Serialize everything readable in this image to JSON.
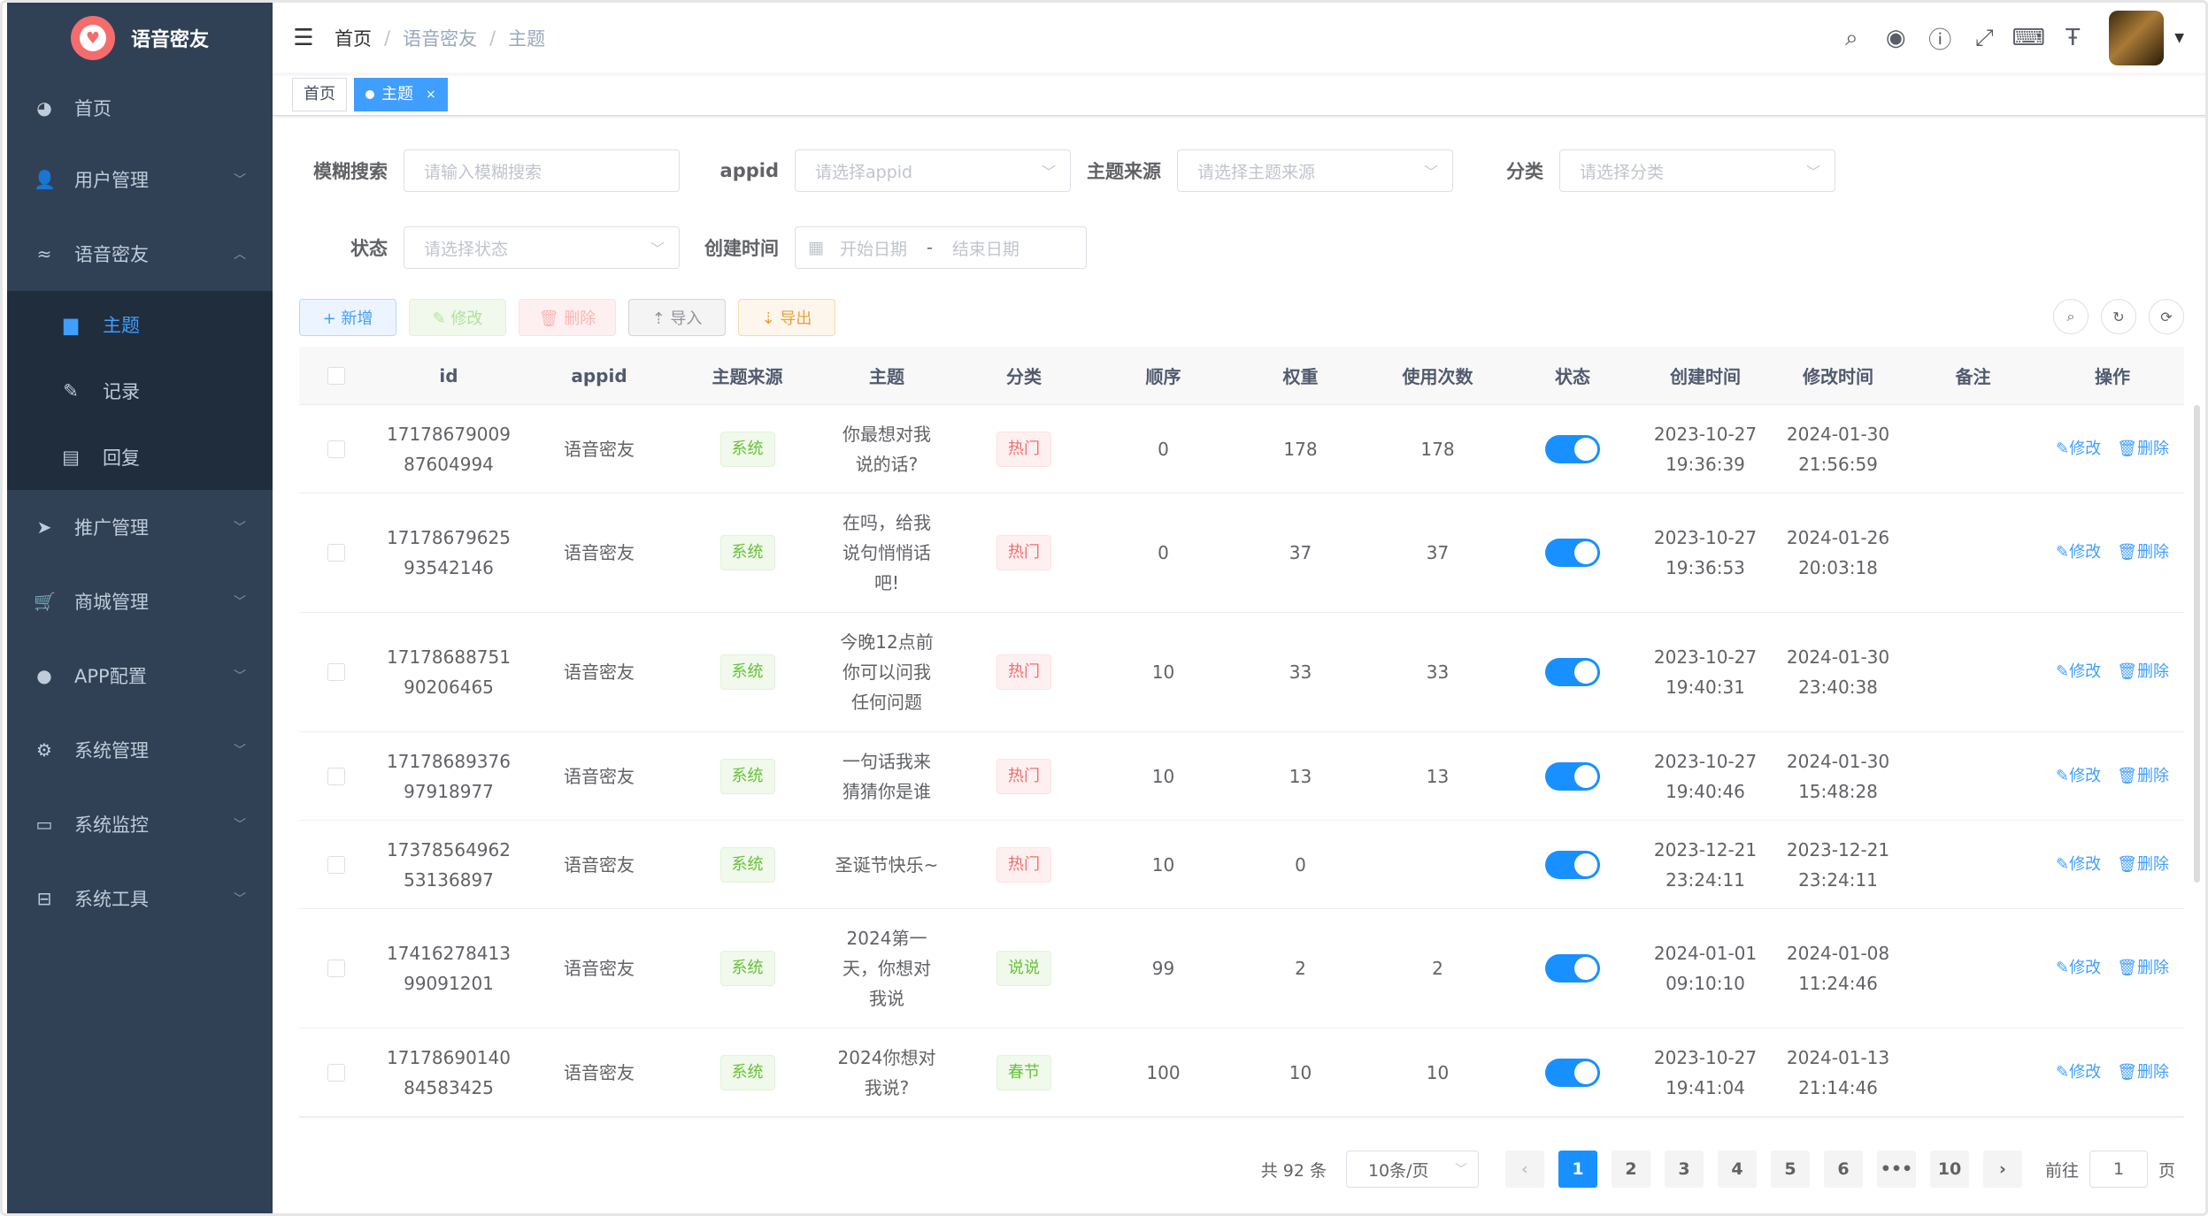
{
  "app": {
    "title": "语音密友"
  },
  "sidebar": {
    "items": [
      {
        "label": "首页",
        "icon": "dashboard-icon"
      },
      {
        "label": "用户管理",
        "icon": "user-icon"
      },
      {
        "label": "语音密友",
        "icon": "eye-icon"
      },
      {
        "label": "推广管理",
        "icon": "send-icon"
      },
      {
        "label": "商城管理",
        "icon": "cart-icon"
      },
      {
        "label": "APP配置",
        "icon": "wechat-icon"
      },
      {
        "label": "系统管理",
        "icon": "gear-icon"
      },
      {
        "label": "系统监控",
        "icon": "monitor-icon"
      },
      {
        "label": "系统工具",
        "icon": "toolbox-icon"
      }
    ],
    "sub_items": [
      {
        "label": "主题",
        "icon": "topic-icon"
      },
      {
        "label": "记录",
        "icon": "edit-icon"
      },
      {
        "label": "回复",
        "icon": "message-icon"
      }
    ]
  },
  "breadcrumb": {
    "home": "首页",
    "level1": "语音密友",
    "level2": "主题"
  },
  "tags": {
    "home": "首页",
    "active": "主题"
  },
  "search": {
    "fuzzy_label": "模糊搜索",
    "fuzzy_placeholder": "请输入模糊搜索",
    "appid_label": "appid",
    "appid_placeholder": "请选择appid",
    "source_label": "主题来源",
    "source_placeholder": "请选择主题来源",
    "category_label": "分类",
    "category_placeholder": "请选择分类",
    "status_label": "状态",
    "status_placeholder": "请选择状态",
    "created_label": "创建时间",
    "start_placeholder": "开始日期",
    "date_sep": "-",
    "end_placeholder": "结束日期"
  },
  "toolbar": {
    "add": "+ 新增",
    "edit": "✎ 修改",
    "delete": "🗑 删除",
    "import": "⇡ 导入",
    "export": "⇣ 导出"
  },
  "table": {
    "headers": [
      "id",
      "appid",
      "主题来源",
      "主题",
      "分类",
      "顺序",
      "权重",
      "使用次数",
      "状态",
      "创建时间",
      "修改时间",
      "备注",
      "操作"
    ],
    "edit_label": "修改",
    "delete_label": "删除",
    "rows": [
      {
        "id1": "17178679009",
        "id2": "87604994",
        "appid": "语音密友",
        "source": "系统",
        "topic": [
          "你最想对我",
          "说的话?"
        ],
        "category": "热门",
        "cat_color": "red",
        "order": "0",
        "weight": "178",
        "uses": "178",
        "created": [
          "2023-10-27",
          "19:36:39"
        ],
        "modified": [
          "2024-01-30",
          "21:56:59"
        ],
        "note": ""
      },
      {
        "id1": "17178679625",
        "id2": "93542146",
        "appid": "语音密友",
        "source": "系统",
        "topic": [
          "在吗，给我",
          "说句悄悄话",
          "吧!"
        ],
        "category": "热门",
        "cat_color": "red",
        "order": "0",
        "weight": "37",
        "uses": "37",
        "created": [
          "2023-10-27",
          "19:36:53"
        ],
        "modified": [
          "2024-01-26",
          "20:03:18"
        ],
        "note": ""
      },
      {
        "id1": "17178688751",
        "id2": "90206465",
        "appid": "语音密友",
        "source": "系统",
        "topic": [
          "今晚12点前",
          "你可以问我",
          "任何问题"
        ],
        "category": "热门",
        "cat_color": "red",
        "order": "10",
        "weight": "33",
        "uses": "33",
        "created": [
          "2023-10-27",
          "19:40:31"
        ],
        "modified": [
          "2024-01-30",
          "23:40:38"
        ],
        "note": ""
      },
      {
        "id1": "17178689376",
        "id2": "97918977",
        "appid": "语音密友",
        "source": "系统",
        "topic": [
          "一句话我来",
          "猜猜你是谁"
        ],
        "category": "热门",
        "cat_color": "red",
        "order": "10",
        "weight": "13",
        "uses": "13",
        "created": [
          "2023-10-27",
          "19:40:46"
        ],
        "modified": [
          "2024-01-30",
          "15:48:28"
        ],
        "note": ""
      },
      {
        "id1": "17378564962",
        "id2": "53136897",
        "appid": "语音密友",
        "source": "系统",
        "topic": [
          "圣诞节快乐~"
        ],
        "category": "热门",
        "cat_color": "red",
        "order": "10",
        "weight": "0",
        "uses": "",
        "created": [
          "2023-12-21",
          "23:24:11"
        ],
        "modified": [
          "2023-12-21",
          "23:24:11"
        ],
        "note": ""
      },
      {
        "id1": "17416278413",
        "id2": "99091201",
        "appid": "语音密友",
        "source": "系统",
        "topic": [
          "2024第一",
          "天，你想对",
          "我说"
        ],
        "category": "说说",
        "cat_color": "green",
        "order": "99",
        "weight": "2",
        "uses": "2",
        "created": [
          "2024-01-01",
          "09:10:10"
        ],
        "modified": [
          "2024-01-08",
          "11:24:46"
        ],
        "note": ""
      },
      {
        "id1": "17178690140",
        "id2": "84583425",
        "appid": "语音密友",
        "source": "系统",
        "topic": [
          "2024你想对",
          "我说?"
        ],
        "category": "春节",
        "cat_color": "green",
        "order": "100",
        "weight": "10",
        "uses": "10",
        "created": [
          "2023-10-27",
          "19:41:04"
        ],
        "modified": [
          "2024-01-13",
          "21:14:46"
        ],
        "note": ""
      }
    ]
  },
  "pagination": {
    "total": "共 92 条",
    "page_size": "10条/页",
    "pages": [
      "1",
      "2",
      "3",
      "4",
      "5",
      "6",
      "•••",
      "10"
    ],
    "current": "1",
    "goto_prefix": "前往",
    "goto_value": "1",
    "goto_suffix": "页"
  }
}
